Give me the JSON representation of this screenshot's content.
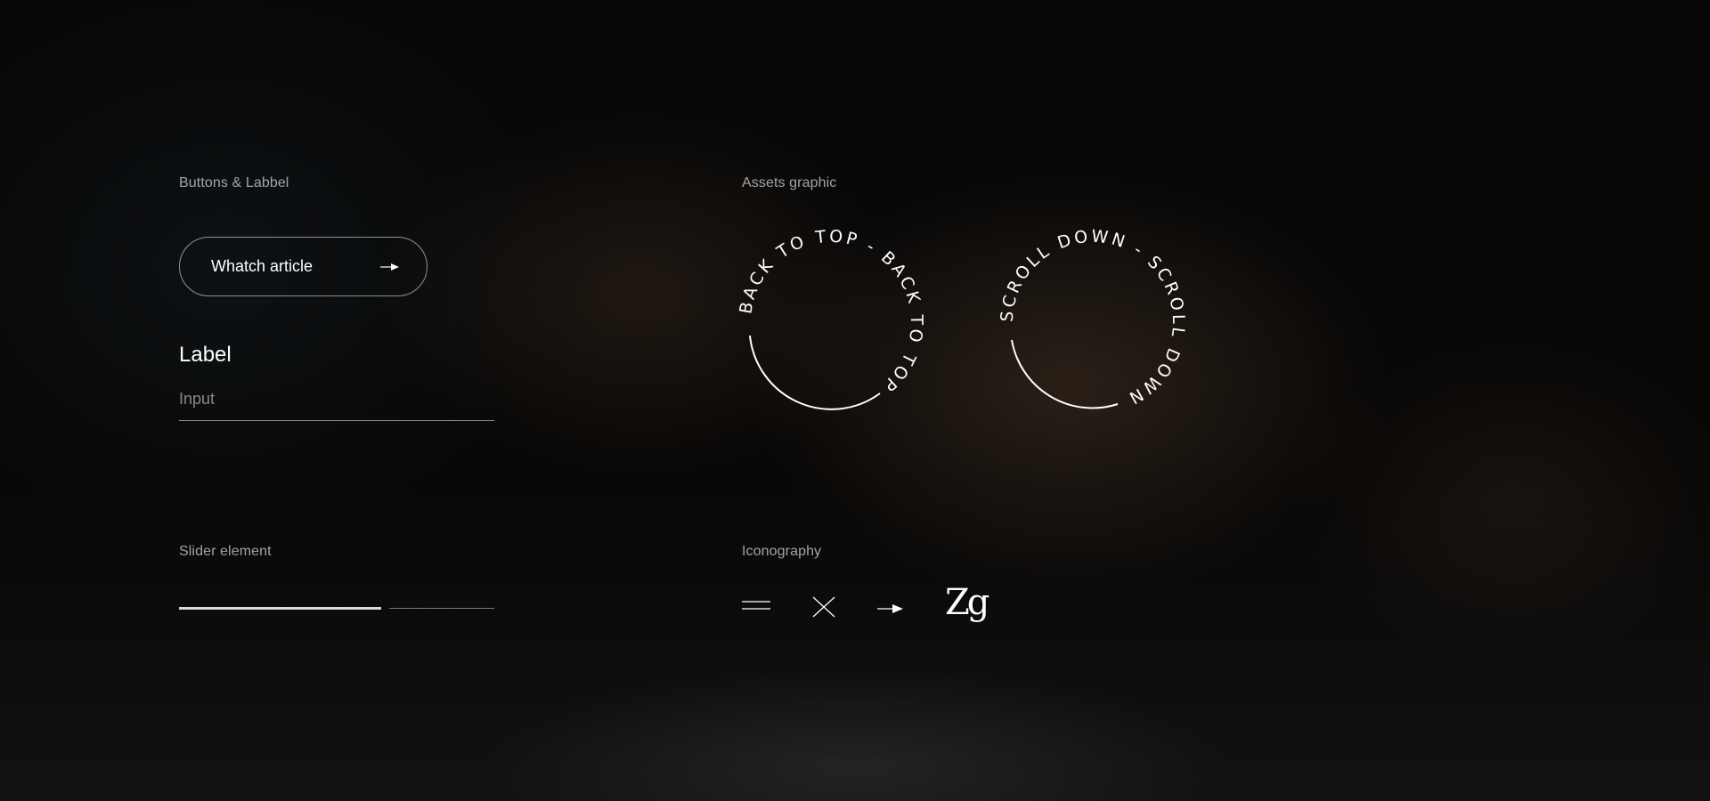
{
  "sections": {
    "buttons_title": "Buttons & Labbel",
    "assets_title": "Assets graphic",
    "slider_title": "Slider element",
    "icons_title": "Iconography"
  },
  "button": {
    "label": "Whatch article",
    "icon": "arrow-right-icon"
  },
  "field": {
    "label": "Label",
    "placeholder": "Input",
    "value": ""
  },
  "slider": {
    "progress": 0.64
  },
  "assets": {
    "back_to_top_text": "BACK TO TOP - BACK TO TOP",
    "scroll_down_text": "SCROLL DOWN - SCROLL DOWN"
  },
  "icons": [
    {
      "name": "menu-icon"
    },
    {
      "name": "close-icon"
    },
    {
      "name": "arrow-right-icon"
    },
    {
      "name": "logo-mark",
      "text": "Zg"
    }
  ],
  "colors": {
    "foreground": "#ffffff",
    "muted_text": "#9e9e9e",
    "background": "#050505"
  }
}
